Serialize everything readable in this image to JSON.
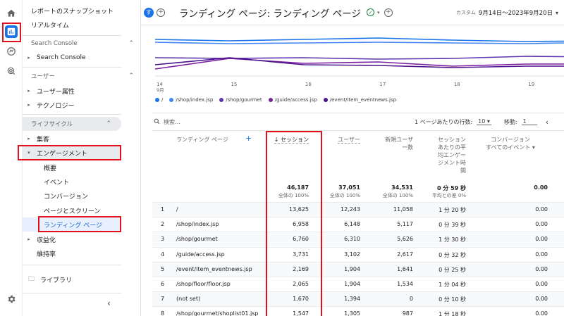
{
  "header": {
    "avatar_letter": "す",
    "title": "ランディング ページ: ランディング ページ",
    "date_label": "カスタム",
    "date_range": "9月14日～2023年9月20日"
  },
  "nav": {
    "snapshot": "レポートのスナップショット",
    "realtime": "リアルタイム",
    "sec_search_console": "Search Console",
    "search_console": "Search Console",
    "sec_user": "ユーザー",
    "user_attr": "ユーザー属性",
    "tech": "テクノロジー",
    "sec_lifecycle": "ライフサイクル",
    "acquisition": "集客",
    "engagement": "エンゲージメント",
    "overview": "概要",
    "event": "イベント",
    "conversion": "コンバージョン",
    "pages_screens": "ページとスクリーン",
    "landing_page": "ランディング ページ",
    "monetization": "収益化",
    "retention": "維持率",
    "library": "ライブラリ"
  },
  "chart_data": {
    "type": "line",
    "x": [
      "14",
      "15",
      "16",
      "17",
      "18",
      "19"
    ],
    "x_sub": "9月",
    "series": [
      {
        "name": "/",
        "color": "#1a73e8"
      },
      {
        "name": "/shop/index.jsp",
        "color": "#4285f4"
      },
      {
        "name": "/shop/gourmet",
        "color": "#5e35b1"
      },
      {
        "name": "/guide/access.jsp",
        "color": "#7b1fa2"
      },
      {
        "name": "/event/item_eventnews.jsp",
        "color": "#4a148c"
      }
    ]
  },
  "toolbar": {
    "search_placeholder": "検索...",
    "rows_label": "1 ページあたりの行数:",
    "rows_value": "10",
    "goto_label": "移動:",
    "goto_value": "1"
  },
  "table": {
    "col_landing": "ランディング ページ",
    "col_sessions": "↓ セッション",
    "col_users": "ユーザー",
    "col_new_users_1": "新規ユーザ",
    "col_new_users_2": "ー数",
    "col_eng_1": "セッション",
    "col_eng_2": "あたりの平",
    "col_eng_3": "均エンゲー",
    "col_eng_4": "ジメント時",
    "col_eng_5": "間",
    "col_conv_1": "コンバージョン",
    "col_conv_2": "すべてのイベント ▾",
    "totals": {
      "sessions": "46,187",
      "sessions_sub": "全体の 100%",
      "users": "37,051",
      "users_sub": "全体の 100%",
      "new_users": "34,531",
      "new_users_sub": "全体の 100%",
      "eng": "0 分 59 秒",
      "eng_sub": "平均との差 0%",
      "conv": "0.00"
    },
    "rows": [
      {
        "n": "1",
        "page": "/",
        "sessions": "13,625",
        "users": "12,243",
        "new": "11,058",
        "eng": "1 分 20 秒",
        "conv": "0.00"
      },
      {
        "n": "2",
        "page": "/shop/index.jsp",
        "sessions": "6,958",
        "users": "6,148",
        "new": "5,117",
        "eng": "0 分 39 秒",
        "conv": "0.00"
      },
      {
        "n": "3",
        "page": "/shop/gourmet",
        "sessions": "6,760",
        "users": "6,310",
        "new": "5,626",
        "eng": "1 分 30 秒",
        "conv": "0.00"
      },
      {
        "n": "4",
        "page": "/guide/access.jsp",
        "sessions": "3,731",
        "users": "3,102",
        "new": "2,617",
        "eng": "0 分 32 秒",
        "conv": "0.00"
      },
      {
        "n": "5",
        "page": "/event/item_eventnews.jsp",
        "sessions": "2,169",
        "users": "1,904",
        "new": "1,641",
        "eng": "0 分 25 秒",
        "conv": "0.00"
      },
      {
        "n": "6",
        "page": "/shop/floor/floor.jsp",
        "sessions": "2,065",
        "users": "1,904",
        "new": "1,534",
        "eng": "1 分 04 秒",
        "conv": "0.00"
      },
      {
        "n": "7",
        "page": "(not set)",
        "sessions": "1,670",
        "users": "1,394",
        "new": "0",
        "eng": "0 分 10 秒",
        "conv": "0.00"
      },
      {
        "n": "8",
        "page": "/shop/gourmet/shoplist01.jsp",
        "sessions": "1,547",
        "users": "1,305",
        "new": "987",
        "eng": "1 分 18 秒",
        "conv": "0.00"
      }
    ]
  }
}
